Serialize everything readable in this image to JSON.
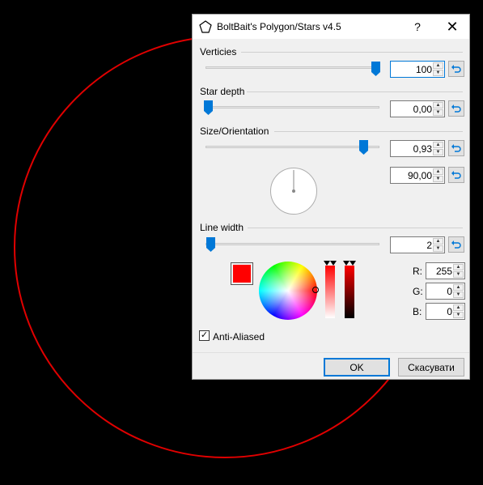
{
  "window": {
    "title": "BoltBait's Polygon/Stars v4.5",
    "help_label": "?",
    "close_label": "✕"
  },
  "sections": {
    "vertices": {
      "label": "Verticies",
      "value": "100",
      "slider_fraction": 1.0
    },
    "star_depth": {
      "label": "Star depth",
      "value": "0,00",
      "slider_fraction": 0.0
    },
    "size_orientation": {
      "label": "Size/Orientation",
      "size_value": "0,93",
      "angle_value": "90,00",
      "slider_fraction": 0.93
    },
    "line_width": {
      "label": "Line width",
      "value": "2",
      "slider_fraction": 0.02
    }
  },
  "color": {
    "primary": "#ff0000",
    "r_label": "R:",
    "r_value": "255",
    "g_label": "G:",
    "g_value": "0",
    "b_label": "B:",
    "b_value": "0"
  },
  "anti_aliased": {
    "label": "Anti-Aliased",
    "checked": true,
    "check_glyph": "✓"
  },
  "buttons": {
    "ok": "OK",
    "cancel": "Скасувати"
  },
  "colors": {
    "accent": "#0078d7",
    "canvas_bg": "#000000",
    "shape_stroke": "#e00000"
  },
  "icons": {
    "app": "pentagon-icon",
    "reset": "undo-arrow-icon"
  }
}
